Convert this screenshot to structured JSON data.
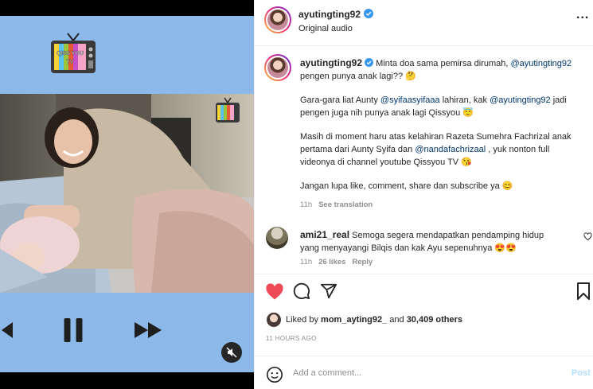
{
  "media": {
    "tv_label_line1": "QISS YOU",
    "tv_label_line2": "TV"
  },
  "header": {
    "username": "ayutingting92",
    "subtitle": "Original audio",
    "more": "..."
  },
  "caption": {
    "username": "ayutingting92",
    "line1": "Minta doa sama pemirsa dirumah,",
    "mention1": "@ayutingting92",
    "line1b": "pengen punya anak lagi?? 🤔",
    "p2a": "Gara-gara liat Aunty",
    "mention2": "@syifaasyifaaa",
    "p2b": "lahiran, kak",
    "mention3": "@ayutingting92",
    "p2c": "jadi pengen juga nih punya anak lagi Qissyou 😇",
    "p3a": "Masih di moment haru atas kelahiran Razeta Sumehra Fachrizal anak pertama dari Aunty Syifa dan",
    "mention4": "@nandafachrizaal",
    "p3b": ", yuk nonton full videonya di channel youtube Qissyou TV 😘",
    "p4": "Jangan lupa like, comment, share dan subscribe ya 😊",
    "time": "11h",
    "see_translation": "See translation"
  },
  "comment": {
    "username": "ami21_real",
    "text": "Semoga segera mendapatkan pendamping hidup yang menyayangi Bilqis dan kak Ayu sepenuhnya 😍😍",
    "time": "11h",
    "likes": "26 likes",
    "reply": "Reply"
  },
  "likes": {
    "prefix": "Liked by",
    "user": "mom_ayting92_",
    "mid": "and",
    "others": "30,409 others"
  },
  "timestamp": "11 HOURS AGO",
  "add_comment": {
    "placeholder": "Add a comment...",
    "post": "Post"
  },
  "icons": {
    "like": "heart-filled-icon",
    "comment": "comment-icon",
    "share": "share-icon",
    "save": "bookmark-icon",
    "emoji": "emoji-icon",
    "mute": "muted-speaker-icon",
    "verified": "verified-badge-icon"
  },
  "colors": {
    "like_red": "#ed4956",
    "verified_blue": "#3897f0",
    "link": "#00376b",
    "media_blue": "#8db8ea"
  }
}
